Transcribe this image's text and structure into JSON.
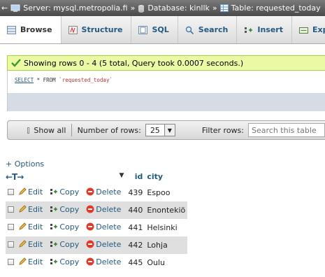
{
  "breadcrumb": {
    "server": "Server: mysql.metropolia.fi",
    "database": "Database: kinllk",
    "table": "Table: requested_today",
    "separator": "»"
  },
  "tabs": [
    {
      "label": "Browse",
      "icon": "browse-icon"
    },
    {
      "label": "Structure",
      "icon": "structure-icon"
    },
    {
      "label": "SQL",
      "icon": "sql-icon"
    },
    {
      "label": "Search",
      "icon": "search-icon"
    },
    {
      "label": "Insert",
      "icon": "insert-icon"
    },
    {
      "label": "Exp",
      "icon": "export-icon"
    }
  ],
  "success_message": "Showing rows 0 - 4 (5 total, Query took 0.0007 seconds.)",
  "sql": {
    "keyword": "SELECT",
    "rest": " * FROM ",
    "table": "`requested_today`"
  },
  "navbar": {
    "show_all": "Show all",
    "rows_label": "Number of rows:",
    "rows_value": "25",
    "filter_label": "Filter rows:",
    "filter_placeholder": "Search this table"
  },
  "options_link": "+ Options",
  "columns": {
    "id": "id",
    "city": "city",
    "sort_arrows": "←T→"
  },
  "actions": {
    "edit": "Edit",
    "copy": "Copy",
    "delete": "Delete"
  },
  "rows": [
    {
      "id": "439",
      "city": "Espoo"
    },
    {
      "id": "440",
      "city": "Enontekiö"
    },
    {
      "id": "441",
      "city": "Helsinki"
    },
    {
      "id": "442",
      "city": "Lohja"
    },
    {
      "id": "445",
      "city": "Oulu"
    }
  ],
  "colors": {
    "link": "#235a81",
    "success_bg": "#ebf8a4",
    "row_alt": "#dfdfdf"
  }
}
